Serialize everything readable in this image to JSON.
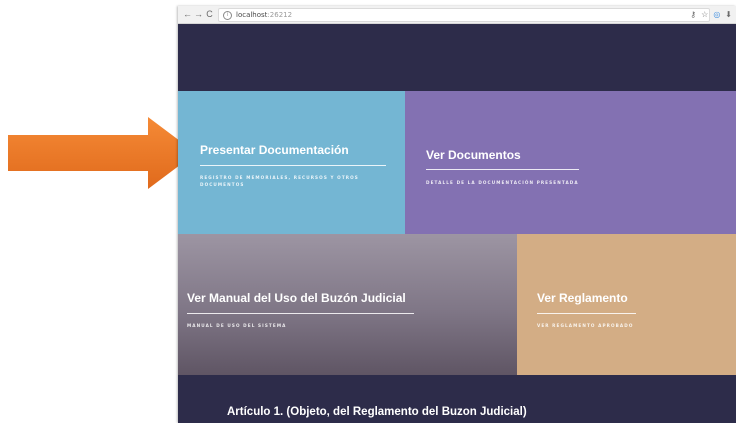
{
  "browser": {
    "url_host": "localhost",
    "url_port": ":26212",
    "nav": {
      "back": "←",
      "forward": "→",
      "reload": "C"
    },
    "icons": [
      "key-icon",
      "star-icon",
      "extension-icon",
      "download-icon"
    ]
  },
  "tiles": [
    {
      "title": "Presentar Documentación",
      "subtitle": "REGISTRO DE MEMORIALES, RECURSOS Y OTROS DOCUMENTOS",
      "color": "#74b6d3"
    },
    {
      "title": "Ver Documentos",
      "subtitle": "DETALLE DE LA DOCUMENTACIÓN PRESENTADA",
      "color": "#8371b2"
    },
    {
      "title": "Ver Manual del Uso del Buzón Judicial",
      "subtitle": "MANUAL DE USO DEL SISTEMA",
      "color": "#7f7686"
    },
    {
      "title": "Ver Reglamento",
      "subtitle": "VER REGLAMENTO APROBADO",
      "color": "#d3ad85"
    }
  ],
  "article_heading": "Artículo 1. (Objeto, del Reglamento del Buzon Judicial)",
  "colors": {
    "background": "#2d2c4a",
    "arrow": "#f07d2b"
  }
}
